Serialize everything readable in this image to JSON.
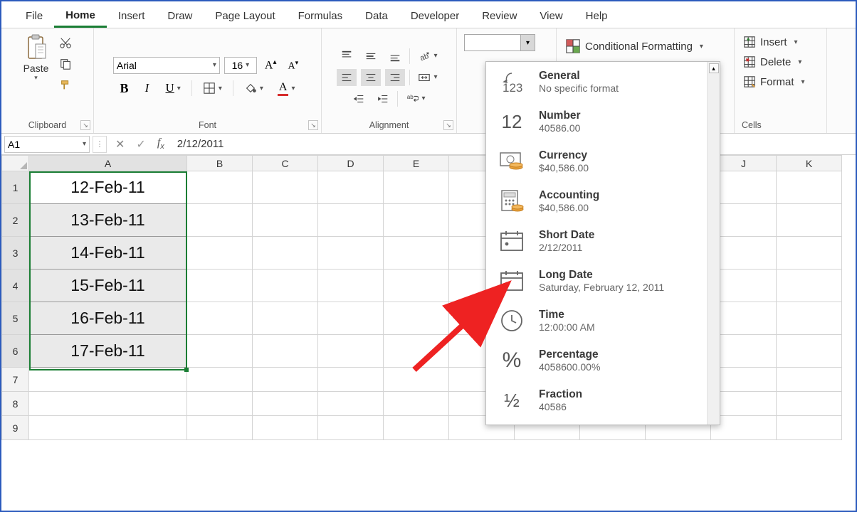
{
  "ribbon_tabs": {
    "file": "File",
    "home": "Home",
    "insert": "Insert",
    "draw": "Draw",
    "page_layout": "Page Layout",
    "formulas": "Formulas",
    "data": "Data",
    "developer": "Developer",
    "review": "Review",
    "view": "View",
    "help": "Help"
  },
  "groups": {
    "clipboard": {
      "label": "Clipboard",
      "paste": "Paste"
    },
    "font": {
      "label": "Font",
      "name": "Arial",
      "size": "16",
      "bold": "B",
      "italic": "I",
      "underline": "U"
    },
    "alignment": {
      "label": "Alignment"
    },
    "styles": {
      "cond_fmt": "Conditional Formatting"
    },
    "cells": {
      "label": "Cells",
      "insert": "Insert",
      "delete": "Delete",
      "format": "Format"
    }
  },
  "number_format_input": "",
  "nf_panel": [
    {
      "title": "General",
      "sub": "No specific format"
    },
    {
      "title": "Number",
      "sub": "40586.00"
    },
    {
      "title": "Currency",
      "sub": "$40,586.00"
    },
    {
      "title": "Accounting",
      "sub": " $40,586.00"
    },
    {
      "title": "Short Date",
      "sub": "2/12/2011"
    },
    {
      "title": "Long Date",
      "sub": "Saturday, February 12, 2011"
    },
    {
      "title": "Time",
      "sub": "12:00:00 AM"
    },
    {
      "title": "Percentage",
      "sub": "4058600.00%"
    },
    {
      "title": "Fraction",
      "sub": "40586"
    }
  ],
  "name_box": "A1",
  "formula_bar": "2/12/2011",
  "columns": [
    "A",
    "B",
    "C",
    "D",
    "E",
    "",
    "",
    "",
    "",
    "J",
    "K"
  ],
  "rows": [
    "1",
    "2",
    "3",
    "4",
    "5",
    "6",
    "7",
    "8",
    "9"
  ],
  "a_col_data": [
    "12-Feb-11",
    "13-Feb-11",
    "14-Feb-11",
    "15-Feb-11",
    "16-Feb-11",
    "17-Feb-11"
  ],
  "col_widths": {
    "A": 222,
    "other": 92
  }
}
